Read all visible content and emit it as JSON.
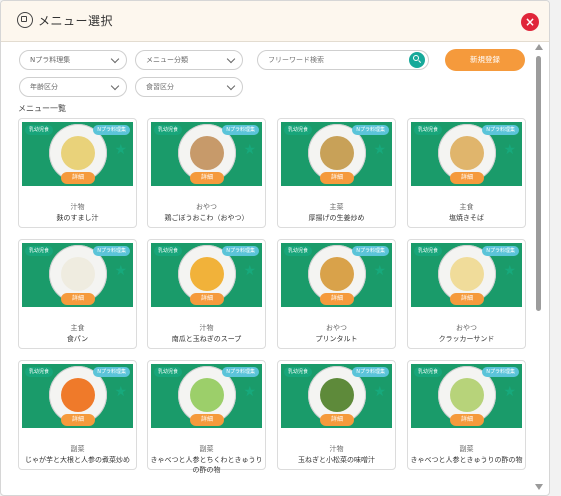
{
  "dialog": {
    "title": "メニュー選択",
    "close_label": "×"
  },
  "filters": {
    "allergy": "Nプラ料理集",
    "menu_category": "メニュー分類",
    "age_group": "年齢区分",
    "meal_category": "食習区分",
    "search_placeholder": "フリーワード検索",
    "register_label": "新規登録"
  },
  "list": {
    "heading": "メニュー一覧",
    "badge_left": "乳幼児食",
    "badge_right": "Nプラ料理集",
    "detail_label": "詳細",
    "star": "★",
    "items": [
      {
        "category": "汁物",
        "name": "麩のすまし汁",
        "food_color": "#e9d27a"
      },
      {
        "category": "おやつ",
        "name": "鶏ごぼうおこわ（おやつ）",
        "food_color": "#c79a6a"
      },
      {
        "category": "主菜",
        "name": "厚揚げの生姜炒め",
        "food_color": "#c8a158"
      },
      {
        "category": "主食",
        "name": "塩焼きそば",
        "food_color": "#e0b56c"
      },
      {
        "category": "主食",
        "name": "食パン",
        "food_color": "#efece0"
      },
      {
        "category": "汁物",
        "name": "南瓜と玉ねぎのスープ",
        "food_color": "#f1b23a"
      },
      {
        "category": "おやつ",
        "name": "プリンタルト",
        "food_color": "#d9a24a"
      },
      {
        "category": "おやつ",
        "name": "クラッカーサンド",
        "food_color": "#f0dc9a"
      },
      {
        "category": "副菜",
        "name": "じゃが芋と大根と人参の煮菜炒め",
        "food_color": "#ef7a2a"
      },
      {
        "category": "副菜",
        "name": "きゃべつと人参とちくわときゅうりの酢の物",
        "food_color": "#9ccf6a"
      },
      {
        "category": "汁物",
        "name": "玉ねぎと小松菜の味噌汁",
        "food_color": "#5e8a3a"
      },
      {
        "category": "副菜",
        "name": "きゃべつと人参ときゅうりの酢の物",
        "food_color": "#b7d37a"
      }
    ]
  },
  "colors": {
    "accent_orange": "#f59a3c",
    "accent_green": "#18a57a",
    "accent_teal": "#5bc4d9",
    "close_red": "#e0263a"
  }
}
